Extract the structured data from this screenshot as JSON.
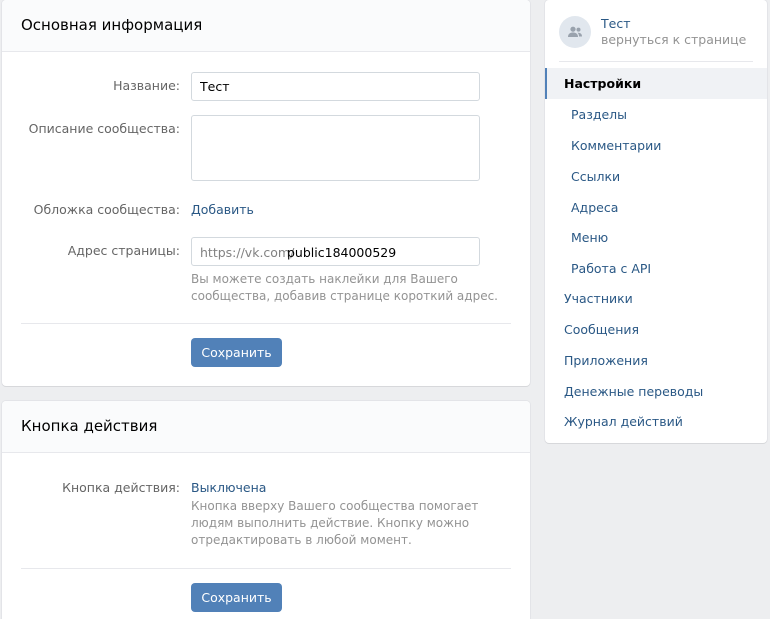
{
  "main": {
    "title": "Основная информация",
    "name_label": "Название:",
    "name_value": "Тест",
    "desc_label": "Описание сообщества:",
    "desc_value": "",
    "cover_label": "Обложка сообщества:",
    "cover_link": "Добавить",
    "address_label": "Адрес страницы:",
    "address_prefix": "https://vk.com/",
    "address_value": "public184000529",
    "address_hint": "Вы можете создать наклейки для Вашего сообщества, добавив странице короткий адрес.",
    "save_label": "Сохранить"
  },
  "action": {
    "title": "Кнопка действия",
    "label": "Кнопка действия:",
    "status_link": "Выключена",
    "hint": "Кнопка вверху Вашего сообщества помогает людям выполнить действие. Кнопку можно отредактировать в любой момент.",
    "save_label": "Сохранить"
  },
  "sidebar": {
    "group_name": "Тест",
    "back_label": "вернуться к странице",
    "items": [
      {
        "label": "Настройки",
        "active": true
      },
      {
        "label": "Разделы"
      },
      {
        "label": "Комментарии"
      },
      {
        "label": "Ссылки"
      },
      {
        "label": "Адреса"
      },
      {
        "label": "Меню"
      },
      {
        "label": "Работа с API"
      },
      {
        "label": "Участники"
      },
      {
        "label": "Сообщения"
      },
      {
        "label": "Приложения"
      },
      {
        "label": "Денежные переводы"
      },
      {
        "label": "Журнал действий"
      }
    ]
  },
  "colors": {
    "accent": "#5181b8",
    "link": "#2a5885",
    "background": "#edeef0"
  }
}
